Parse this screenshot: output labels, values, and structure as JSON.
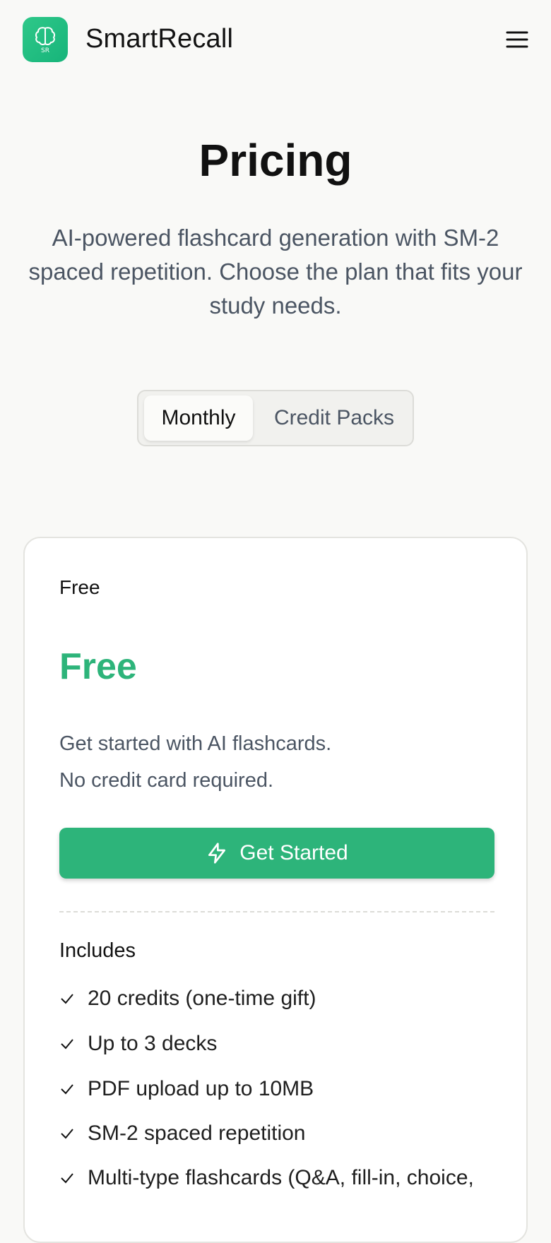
{
  "header": {
    "logo_text": "SR",
    "brand": "SmartRecall",
    "menu_icon": "hamburger-menu-icon"
  },
  "hero": {
    "title": "Pricing",
    "subtitle": "AI-powered flashcard generation with SM-2 spaced repetition. Choose the plan that fits your study needs."
  },
  "billing_toggle": {
    "options": [
      {
        "label": "Monthly",
        "active": true
      },
      {
        "label": "Credit Packs",
        "active": false
      }
    ]
  },
  "plan": {
    "name": "Free",
    "price": "Free",
    "description_line1": "Get started with AI flashcards.",
    "description_line2": "No credit card required.",
    "cta_label": "Get Started",
    "cta_icon": "lightning-icon",
    "includes_title": "Includes",
    "features": [
      "20 credits (one-time gift)",
      "Up to 3 decks",
      "PDF upload up to 10MB",
      "SM-2 spaced repetition",
      "Multi-type flashcards (Q&A, fill-in, choice,"
    ]
  },
  "colors": {
    "accent": "#2db47a",
    "background": "#f9f9f7",
    "muted_text": "#4b5563"
  }
}
